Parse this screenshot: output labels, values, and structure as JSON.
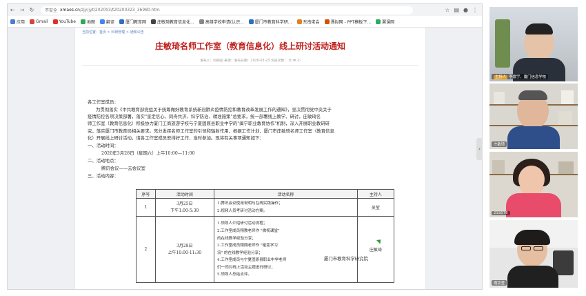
{
  "browser": {
    "insecure_label": "不安全",
    "url_host": "xmaes.cn",
    "url_path": "/zjy/jyt/202003/t20200323_36980.htm",
    "bookmarks": [
      "应用",
      "Gmail",
      "YouTube",
      "地图",
      "翻译",
      "厦门教育网",
      "庄敏琦教育信息化...",
      "高雄学校申请(认识...",
      "厦门市教育科学研...",
      "东南佬会",
      "漂拟网 - PPT模板下...",
      "翼课网"
    ]
  },
  "article": {
    "breadcrumb": "当前位置：首页 > 科研管理 > 通知公告",
    "title": "庄敏琦名师工作室（教育信息化）线上研讨活动通知",
    "meta": "发布人：科研处    来源：发布日期：2020-03-23    浏览次数：    大  中  小",
    "greeting": "各工作室成员：",
    "body_lines": [
      "为贯彻落实《中共教育部党组关于统筹做好教育系统新冠肺炎疫情防控和教育改革发展工作的通知》，坚决贯彻党中央关于",
      "疫情防控各项决策部署，落实\"坚定信心、同舟共济、科学防治、精准施策\"总要求，统一部署线上教学、研讨，庄敏琦名",
      "师工作室（教育信息化）积极协力厦门工商旅游学校与宁夏固原县职业中学的\"闽宁职业教育协作\"机制，深入开展职业教研研",
      "究，落实厦门市教育局相关要求。充分发挥名师工作室的引领和辐射作用，根据工作计划，厦门市庄敏琦名师工作室（教育信息",
      "化）开展线上研讨活动，请各工作室成员安排好工作，准时参加。现将有关事项通知如下："
    ],
    "sections": {
      "time_heading": "一、活动时间：",
      "time_value": "2020年3月28日（星期六）上午10:00—11:00",
      "place_heading": "二、活动地点：",
      "place_value": "腾讯会议——云会议室",
      "content_heading": "三、活动内容："
    },
    "table": {
      "headers": [
        "序号",
        "活动时间",
        "活动名称",
        "主持人"
      ],
      "rows": [
        {
          "no": "1",
          "time_1": "3月25日",
          "time_2": "下午1:00-5:30",
          "items": [
            "1.腾讯会议使用说明与在线实践操作；",
            "2.视频人员考研讨活动方案。"
          ],
          "host": "吴莹"
        },
        {
          "no": "2",
          "time_1": "3月28日",
          "time_2": "上午10:00-11:30",
          "items": [
            "1.领导人介绍研讨活动流程；",
            "2.工作室成员翔教老师作 \"微视课堂\"",
            "的在线教学经验分享；",
            "3.工作室成员翔翔老师作 \"碰变学习",
            "流\" 的在线教学经验分享；",
            "4.工作室成员与宁夏固原县职业中学老师",
            "们一同对线上活动主题进行研讨；",
            "5.领导人总结点评。"
          ],
          "host": "庄敏琦"
        }
      ]
    },
    "footer_unit": "厦门市教育科学研究院"
  },
  "video_panel": {
    "participants": [
      {
        "tag": "主持人",
        "name": "李震宇、厦门信息学校"
      },
      {
        "tag": "",
        "name": "庄敏琦"
      },
      {
        "tag": "",
        "name": "21S076"
      },
      {
        "tag": "",
        "name": "周钦莹"
      }
    ]
  },
  "colors": {
    "title_red": "#c0231f",
    "link_blue": "#5b86c5",
    "tag_orange": "#e39b1e"
  }
}
